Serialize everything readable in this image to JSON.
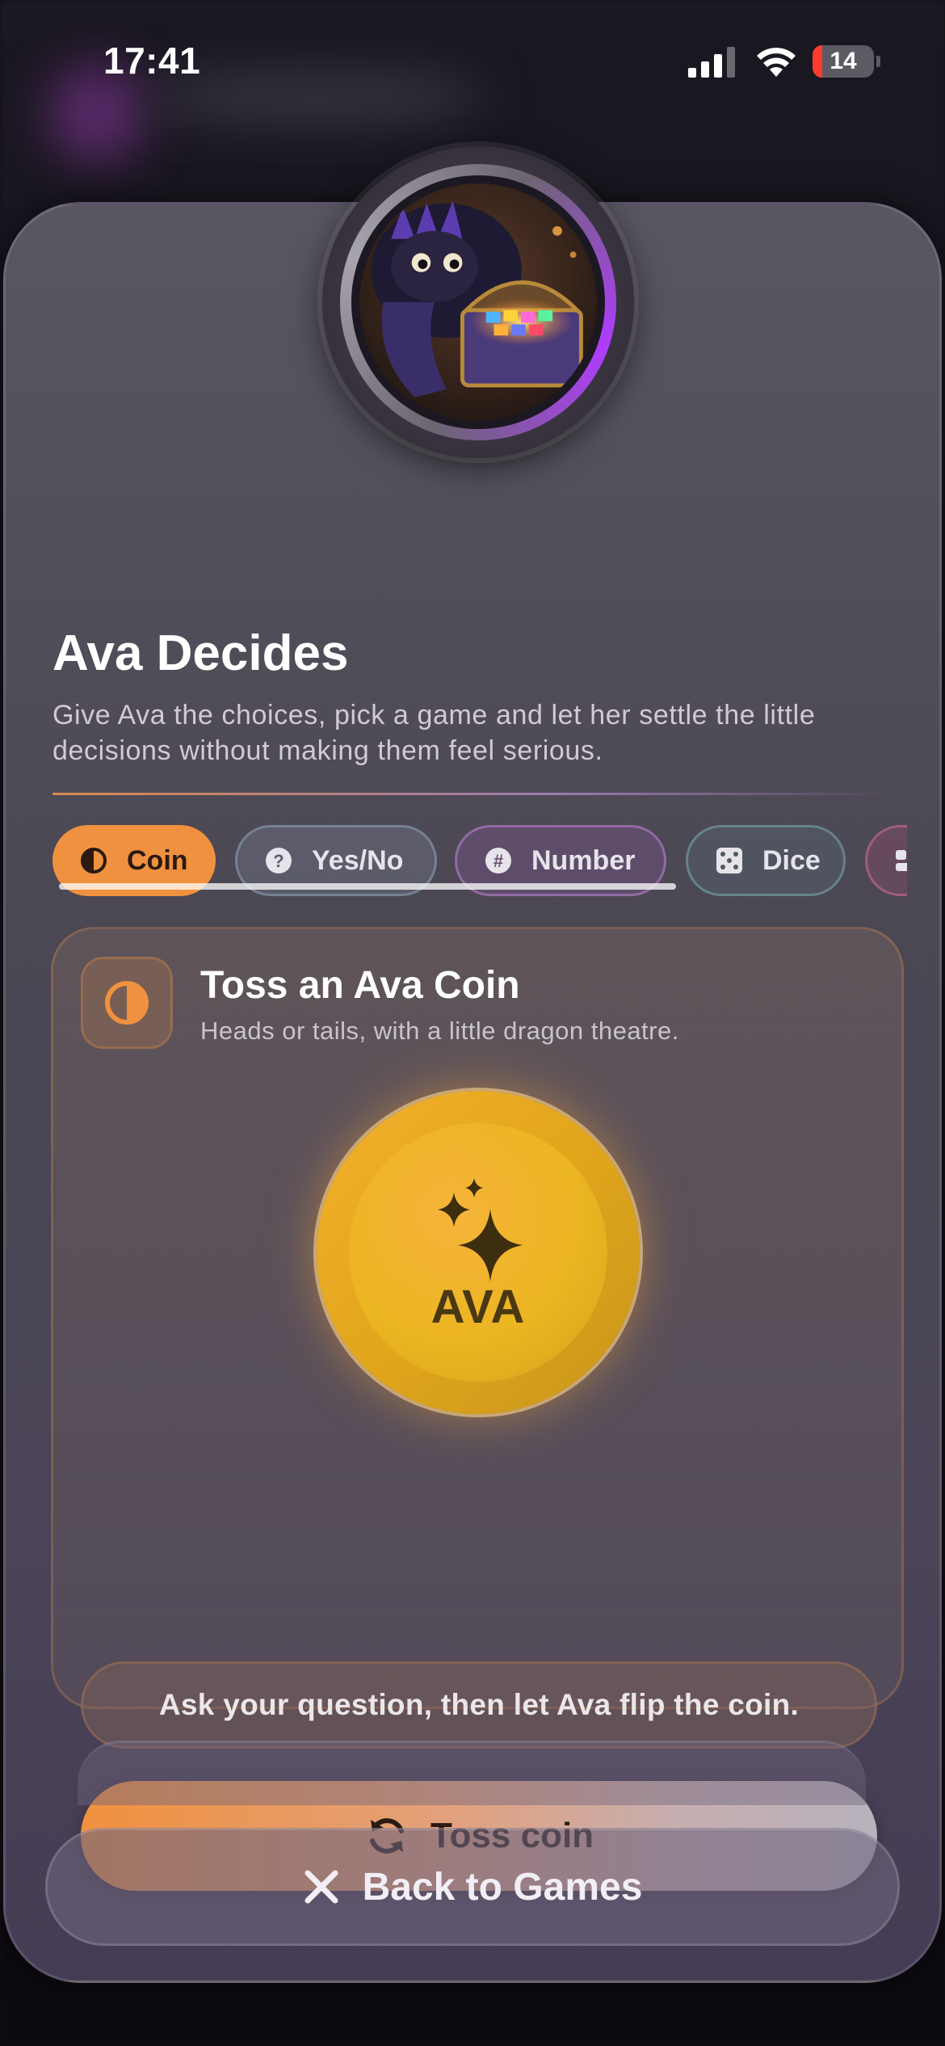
{
  "status_bar": {
    "time": "17:41",
    "battery_level": "14",
    "icons": [
      "signal-icon",
      "wifi-icon",
      "battery-icon"
    ]
  },
  "header": {
    "avatar": "dragon-treasure-avatar",
    "title": "Ava Decides",
    "subtitle": "Give Ava the choices, pick a game and let her settle the little decisions without making them feel serious."
  },
  "tabs": [
    {
      "label": "Coin",
      "icon": "half-circle-icon",
      "selected": true
    },
    {
      "label": "Yes/No",
      "icon": "question-circle-icon",
      "selected": false
    },
    {
      "label": "Number",
      "icon": "hash-circle-icon",
      "selected": false
    },
    {
      "label": "Dice",
      "icon": "dice-icon",
      "selected": false
    },
    {
      "label": "",
      "icon": "quote-icon",
      "selected": false
    }
  ],
  "coin_card": {
    "title": "Toss an Ava Coin",
    "subtitle": "Heads or tails, with a little dragon theatre.",
    "coin_label": "AVA",
    "prompt": "Ask your question, then let Ava flip the coin.",
    "button_label": "Toss coin"
  },
  "footer": {
    "back_label": "Back to Games"
  },
  "colors": {
    "accent": "#f0913f",
    "coin_gold": "#e9b024",
    "sheet": "#4f4a58"
  }
}
